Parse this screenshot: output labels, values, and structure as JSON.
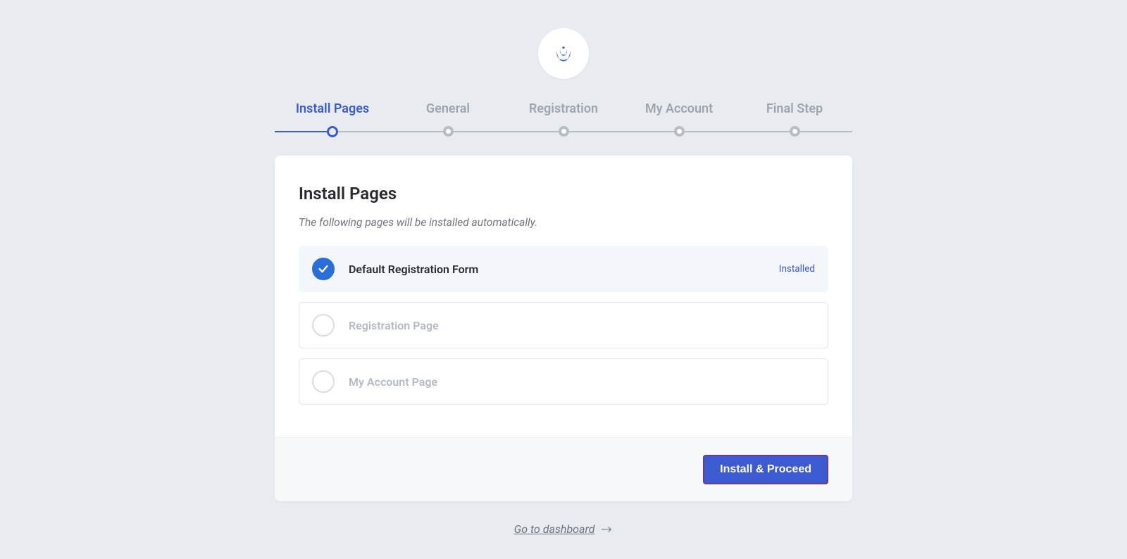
{
  "stepper": {
    "steps": [
      {
        "label": "Install Pages",
        "active": true
      },
      {
        "label": "General",
        "active": false
      },
      {
        "label": "Registration",
        "active": false
      },
      {
        "label": "My Account",
        "active": false
      },
      {
        "label": "Final Step",
        "active": false
      }
    ]
  },
  "card": {
    "title": "Install Pages",
    "subtitle": "The following pages will be installed automatically."
  },
  "pages": [
    {
      "name": "Default Registration Form",
      "installed": true,
      "status": "Installed"
    },
    {
      "name": "Registration Page",
      "installed": false,
      "status": ""
    },
    {
      "name": "My Account Page",
      "installed": false,
      "status": ""
    }
  ],
  "footer": {
    "primary_label": "Install & Proceed"
  },
  "dashboard_link": "Go to dashboard"
}
